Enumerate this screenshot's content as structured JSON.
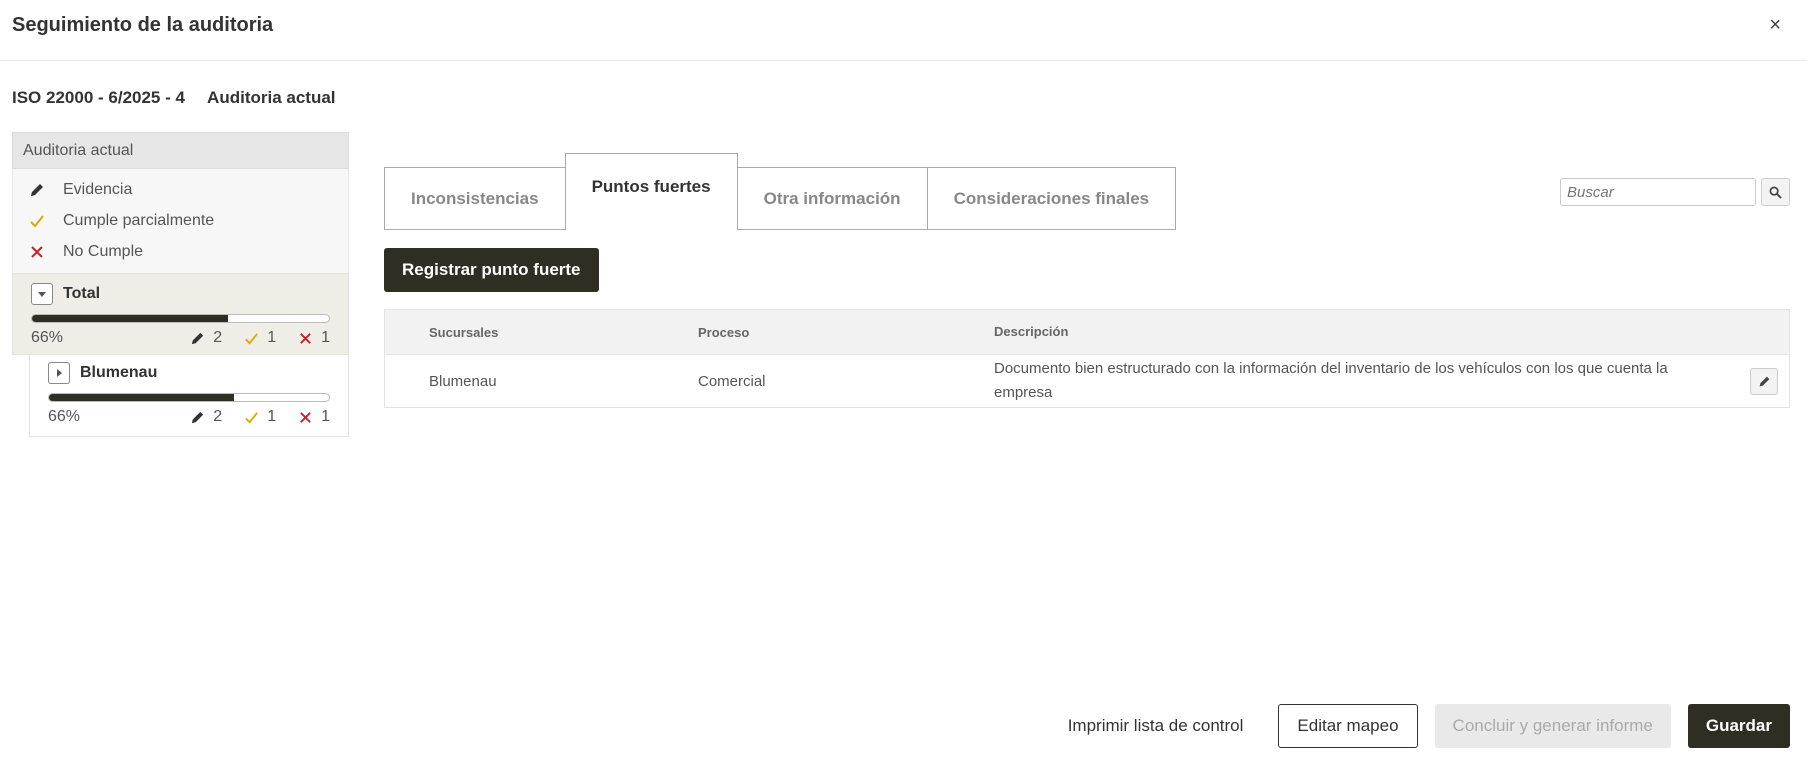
{
  "modal": {
    "title": "Seguimiento de la auditoria",
    "close_label": "×"
  },
  "audit": {
    "code": "ISO 22000 - 6/2025 - 4",
    "status": "Auditoria actual"
  },
  "left_panel": {
    "header": "Auditoria actual",
    "legend": [
      {
        "icon": "pencil-icon",
        "label": "Evidencia",
        "color": "#333333"
      },
      {
        "icon": "check-icon",
        "label": "Cumple parcialmente",
        "color": "#e0a800"
      },
      {
        "icon": "x-icon",
        "label": "No Cumple",
        "color": "#cc1f2f"
      }
    ],
    "total": {
      "label": "Total",
      "progress": 0.66,
      "percent": "66%",
      "evidence": "2",
      "partial": "1",
      "noncompliant": "1"
    },
    "children": [
      {
        "label": "Blumenau",
        "progress": 0.66,
        "percent": "66%",
        "evidence": "2",
        "partial": "1",
        "noncompliant": "1"
      }
    ]
  },
  "tabs": [
    {
      "label": "Inconsistencias",
      "active": false
    },
    {
      "label": "Puntos fuertes",
      "active": true
    },
    {
      "label": "Otra información",
      "active": false
    },
    {
      "label": "Consideraciones finales",
      "active": false
    }
  ],
  "search": {
    "placeholder": "Buscar"
  },
  "register_button": "Registrar punto fuerte",
  "table": {
    "headers": [
      "Sucursales",
      "Proceso",
      "Descripción"
    ],
    "rows": [
      {
        "sucursal": "Blumenau",
        "proceso": "Comercial",
        "descripcion": "Documento bien estructurado con la información del inventario de los vehículos con los que cuenta la empresa"
      }
    ]
  },
  "footer": {
    "print": "Imprimir lista de control",
    "edit_map": "Editar mapeo",
    "conclude": "Concluir y generar informe",
    "save": "Guardar"
  },
  "colors": {
    "primary": "#2e2f22",
    "check": "#e0a800",
    "cross": "#cc1f2f"
  }
}
